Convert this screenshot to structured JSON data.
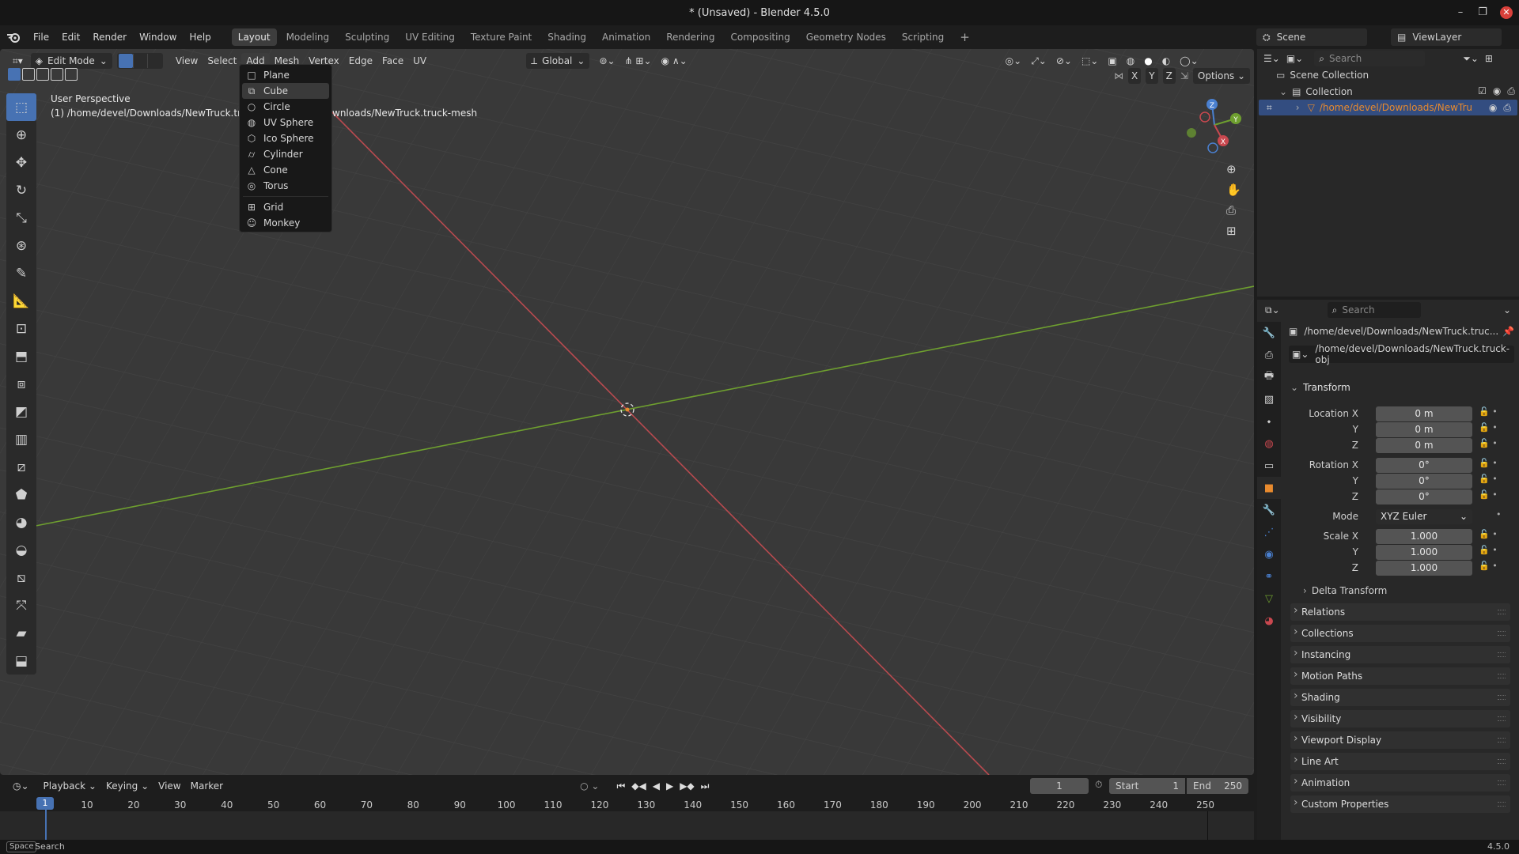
{
  "window": {
    "title": "* (Unsaved) - Blender 4.5.0"
  },
  "menu": [
    "File",
    "Edit",
    "Render",
    "Window",
    "Help"
  ],
  "workspaces": [
    "Layout",
    "Modeling",
    "Sculpting",
    "UV Editing",
    "Texture Paint",
    "Shading",
    "Animation",
    "Rendering",
    "Compositing",
    "Geometry Nodes",
    "Scripting"
  ],
  "active_workspace": "Layout",
  "scene": {
    "label": "Scene",
    "view_layer": "ViewLayer"
  },
  "viewport": {
    "mode": "Edit Mode",
    "menus": [
      "View",
      "Select",
      "Add",
      "Mesh",
      "Vertex",
      "Edge",
      "Face",
      "UV"
    ],
    "orientation": "Global",
    "perspective_label": "User Perspective",
    "object_label_left": "(1) /home/devel/Downloads/NewTruck.truck",
    "object_label_right": "wnloads/NewTruck.truck-mesh",
    "options_label": "Options",
    "axes": [
      "X",
      "Y",
      "Z"
    ],
    "gizmo_axes": [
      "Z",
      "Y",
      "X"
    ]
  },
  "add_menu": {
    "items": [
      "Plane",
      "Cube",
      "Circle",
      "UV Sphere",
      "Ico Sphere",
      "Cylinder",
      "Cone",
      "Torus",
      "Grid",
      "Monkey"
    ],
    "highlighted": "Cube"
  },
  "outliner": {
    "search_placeholder": "Search",
    "scene_collection": "Scene Collection",
    "collection": "Collection",
    "object": "/home/devel/Downloads/NewTru"
  },
  "properties": {
    "search_placeholder": "Search",
    "object_path": "/home/devel/Downloads/NewTruck.truc...",
    "object_name": "/home/devel/Downloads/NewTruck.truck-obj",
    "transform_label": "Transform",
    "location_label": "Location X",
    "rotation_label": "Rotation X",
    "scale_label": "Scale X",
    "y_label": "Y",
    "z_label": "Z",
    "location": [
      "0 m",
      "0 m",
      "0 m"
    ],
    "rotation": [
      "0°",
      "0°",
      "0°"
    ],
    "mode_label": "Mode",
    "mode_value": "XYZ Euler",
    "scale": [
      "1.000",
      "1.000",
      "1.000"
    ],
    "delta_transform": "Delta Transform",
    "panels": [
      "Relations",
      "Collections",
      "Instancing",
      "Motion Paths",
      "Shading",
      "Visibility",
      "Viewport Display",
      "Line Art",
      "Animation",
      "Custom Properties"
    ]
  },
  "timeline": {
    "menus": [
      "Playback",
      "Keying",
      "View",
      "Marker"
    ],
    "current_frame": "1",
    "start_label": "Start",
    "start": "1",
    "end_label": "End",
    "end": "250",
    "ticks": [
      "10",
      "20",
      "30",
      "40",
      "50",
      "60",
      "70",
      "80",
      "90",
      "100",
      "110",
      "120",
      "130",
      "140",
      "150",
      "160",
      "170",
      "180",
      "190",
      "200",
      "210",
      "220",
      "230",
      "240",
      "250"
    ],
    "playhead": "1"
  },
  "statusbar": {
    "key": "Space",
    "action": "Search",
    "version": "4.5.0"
  },
  "colors": {
    "accent": "#4772b3",
    "x_axis": "#c9484f",
    "y_axis": "#6e9f2f",
    "z_axis": "#4a80d0",
    "object_orange": "#e88a2e"
  }
}
